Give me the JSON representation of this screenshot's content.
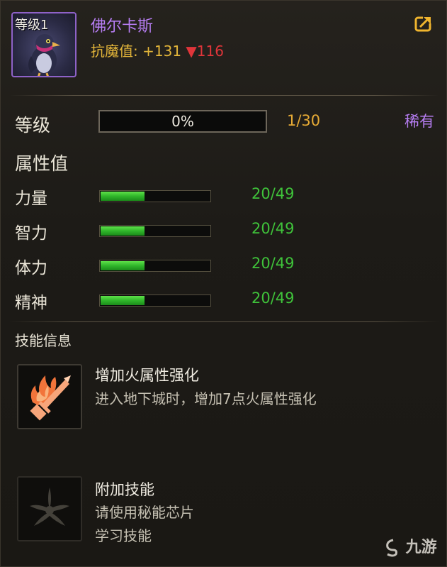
{
  "pet": {
    "level_badge": "等级1",
    "name": "佛尔卡斯",
    "resist_label": "抗魔值:",
    "resist_value": "+131",
    "resist_down": "▼116"
  },
  "level": {
    "label": "等级",
    "progress_text": "0%",
    "progress": 0,
    "count": "1/30",
    "rarity": "稀有"
  },
  "attributes": {
    "title": "属性值",
    "items": [
      {
        "name": "力量",
        "value": "20/49",
        "fill": 0.41
      },
      {
        "name": "智力",
        "value": "20/49",
        "fill": 0.41
      },
      {
        "name": "体力",
        "value": "20/49",
        "fill": 0.41
      },
      {
        "name": "精神",
        "value": "20/49",
        "fill": 0.41
      }
    ]
  },
  "skills": {
    "title": "技能信息",
    "items": [
      {
        "name": "增加火属性强化",
        "desc1": "进入地下城时，增加7点火属性强化",
        "desc2": "",
        "icon": "flame-sword-icon"
      },
      {
        "name": "附加技能",
        "desc1": "请使用秘能芯片",
        "desc2": "学习技能",
        "icon": "locked-skill-icon"
      }
    ]
  },
  "colors": {
    "name": "#b67df2",
    "gold": "#e3b53a",
    "down": "#e0353a",
    "stat_green": "#3fc23a",
    "rarity": "#b67df2"
  },
  "watermark": {
    "text": "九游",
    "icon": "jiuyou-logo-icon"
  }
}
